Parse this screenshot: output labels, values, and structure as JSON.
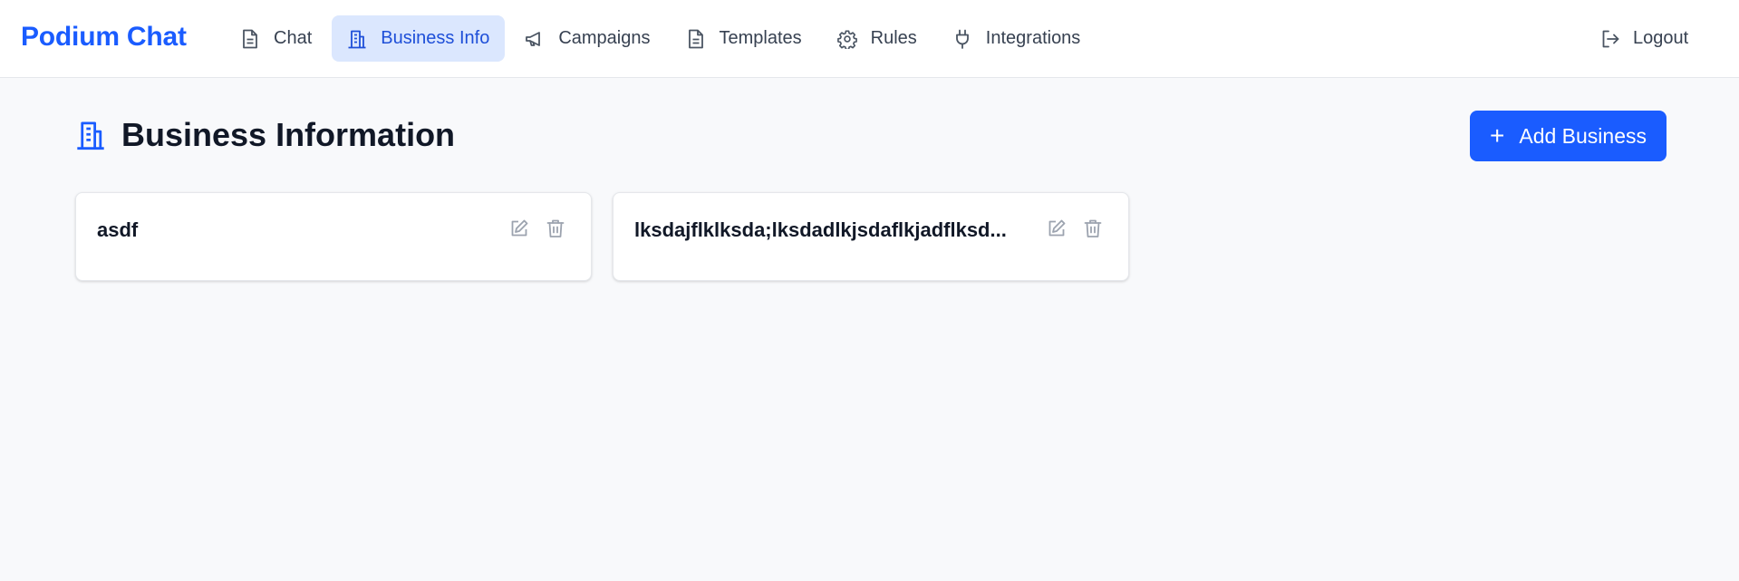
{
  "app": {
    "brand": "Podium Chat"
  },
  "nav": {
    "items": [
      {
        "label": "Chat",
        "icon": "document-icon",
        "active": false
      },
      {
        "label": "Business Info",
        "icon": "building-icon",
        "active": true
      },
      {
        "label": "Campaigns",
        "icon": "megaphone-icon",
        "active": false
      },
      {
        "label": "Templates",
        "icon": "document-icon",
        "active": false
      },
      {
        "label": "Rules",
        "icon": "gear-icon",
        "active": false
      },
      {
        "label": "Integrations",
        "icon": "plug-icon",
        "active": false
      }
    ],
    "logout_label": "Logout"
  },
  "page": {
    "title": "Business Information",
    "add_button_label": "Add Business"
  },
  "businesses": [
    {
      "name": "asdf"
    },
    {
      "name": "lksdajflklksda;lksdadlkjsdaflkjadflksd..."
    }
  ],
  "colors": {
    "brand": "#1a5cff",
    "active_nav_bg": "#dbe7fe",
    "active_nav_text": "#1e4fd8",
    "page_bg": "#f8f9fb",
    "icon_muted": "#9ca3af"
  }
}
